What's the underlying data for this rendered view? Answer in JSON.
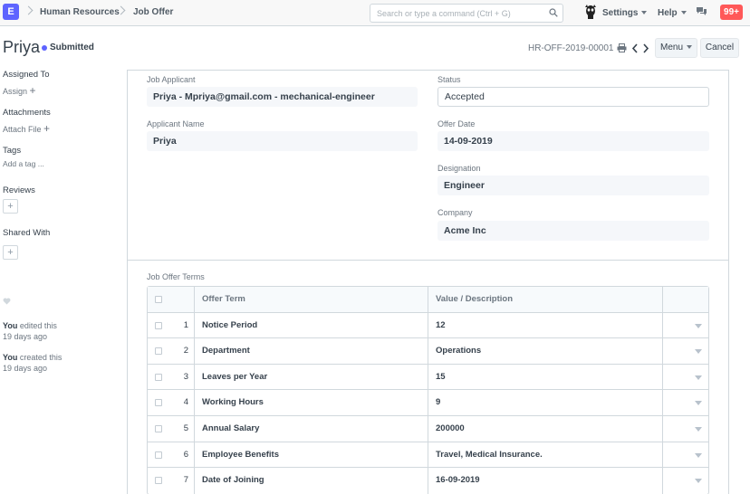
{
  "navbar": {
    "logo_letter": "E",
    "breadcrumbs": [
      "Human Resources",
      "Job Offer"
    ],
    "search_placeholder": "Search or type a command (Ctrl + G)",
    "settings_label": "Settings",
    "help_label": "Help",
    "notification_count": "99+",
    "colors": {
      "brand": "#5e64ff",
      "badge": "#ff5858"
    }
  },
  "page": {
    "title": "Priya",
    "status": "Submitted",
    "doc_name": "HR-OFF-2019-00001",
    "menu_label": "Menu",
    "cancel_label": "Cancel"
  },
  "sidebar": {
    "assigned_to": "Assigned To",
    "assign": "Assign",
    "attachments": "Attachments",
    "attach_file": "Attach File",
    "tags": "Tags",
    "add_tag": "Add a tag ...",
    "reviews": "Reviews",
    "shared_with": "Shared With",
    "activity": [
      {
        "who": "You",
        "action": "edited this",
        "when": "19 days ago"
      },
      {
        "who": "You",
        "action": "created this",
        "when": "19 days ago"
      }
    ]
  },
  "form": {
    "job_applicant_label": "Job Applicant",
    "job_applicant_value": "Priya - Mpriya@gmail.com - mechanical-engineer",
    "applicant_name_label": "Applicant Name",
    "applicant_name_value": "Priya",
    "status_label": "Status",
    "status_value": "Accepted",
    "offer_date_label": "Offer Date",
    "offer_date_value": "14-09-2019",
    "designation_label": "Designation",
    "designation_value": "Engineer",
    "company_label": "Company",
    "company_value": "Acme Inc",
    "terms_section_label": "Job Offer Terms"
  },
  "terms_table": {
    "columns": [
      "Offer Term",
      "Value / Description"
    ],
    "rows": [
      {
        "idx": "1",
        "term": "Notice Period",
        "value": "12"
      },
      {
        "idx": "2",
        "term": "Department",
        "value": "Operations"
      },
      {
        "idx": "3",
        "term": "Leaves per Year",
        "value": "15"
      },
      {
        "idx": "4",
        "term": "Working Hours",
        "value": "9"
      },
      {
        "idx": "5",
        "term": "Annual Salary",
        "value": "200000"
      },
      {
        "idx": "6",
        "term": "Employee Benefits",
        "value": "Travel, Medical Insurance."
      },
      {
        "idx": "7",
        "term": "Date of Joining",
        "value": "16-09-2019"
      }
    ]
  }
}
